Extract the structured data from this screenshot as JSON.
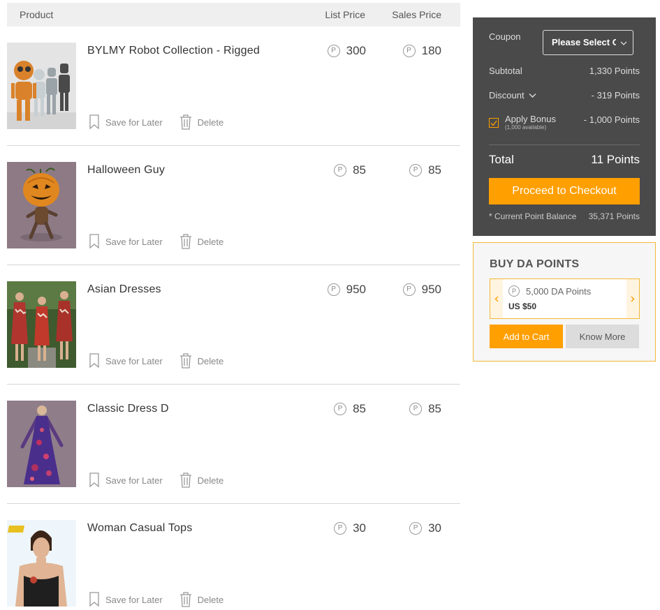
{
  "cart": {
    "headers": {
      "product": "Product",
      "list_price": "List Price",
      "sales_price": "Sales Price"
    },
    "point_symbol": "P",
    "save_label": "Save for Later",
    "delete_label": "Delete",
    "items": [
      {
        "name": "BYLMY Robot Collection - Rigged",
        "list_price": "300",
        "sales_price": "180"
      },
      {
        "name": "Halloween Guy",
        "list_price": "85",
        "sales_price": "85"
      },
      {
        "name": "Asian Dresses",
        "list_price": "950",
        "sales_price": "950"
      },
      {
        "name": "Classic Dress D",
        "list_price": "85",
        "sales_price": "85"
      },
      {
        "name": "Woman Casual Tops",
        "list_price": "30",
        "sales_price": "30"
      }
    ]
  },
  "summary": {
    "coupon_label": "Coupon",
    "coupon_select": "Please Select C",
    "subtotal_label": "Subtotal",
    "subtotal_value": "1,330 Points",
    "discount_label": "Discount",
    "discount_value": "- 319 Points",
    "bonus_label": "Apply Bonus",
    "bonus_available": "(1,000 available)",
    "bonus_value": "- 1,000 Points",
    "bonus_checked": true,
    "total_label": "Total",
    "total_value": "11 Points",
    "checkout_label": "Proceed to Checkout",
    "balance_label": "* Current Point Balance",
    "balance_value": "35,371 Points"
  },
  "buy_points": {
    "title": "BUY DA POINTS",
    "package_name": "5,000 DA Points",
    "package_price": "US $50",
    "add_label": "Add to Cart",
    "more_label": "Know More"
  },
  "colors": {
    "accent": "#ff9f00",
    "summary_bg": "#4a4a4a",
    "header_bg": "#efefef",
    "border_gold": "#f2b838"
  }
}
